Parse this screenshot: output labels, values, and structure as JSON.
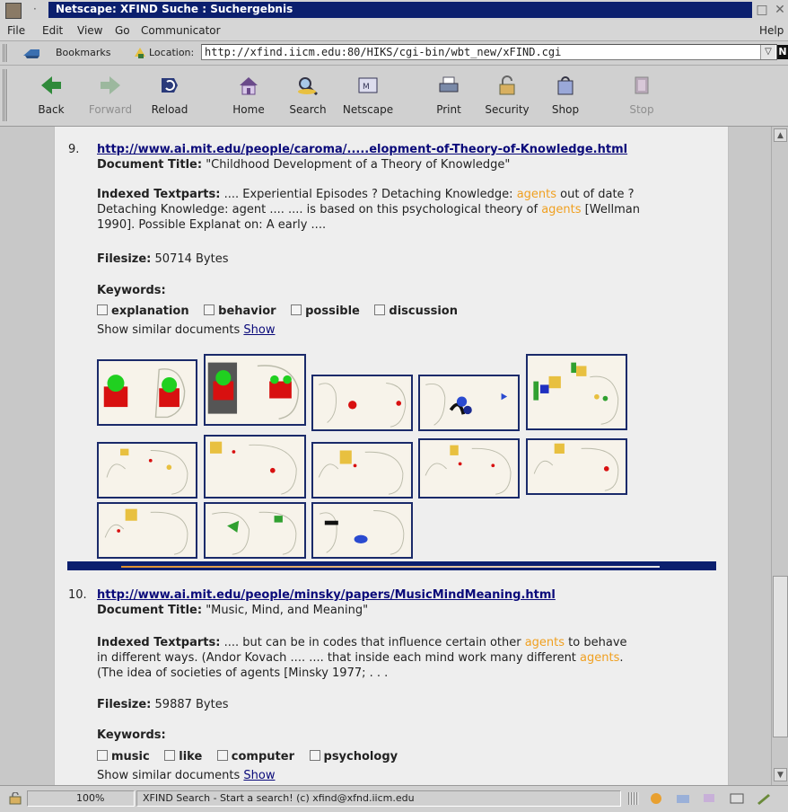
{
  "window": {
    "title": "Netscape: XFIND Suche : Suchergebnis"
  },
  "menu": [
    "File",
    "Edit",
    "View",
    "Go",
    "Communicator",
    "Help"
  ],
  "location_bar": {
    "bookmarks_label": "Bookmarks",
    "location_label": "Location:",
    "url": "http://xfind.iicm.edu:80/HIKS/cgi-bin/wbt_new/xFIND.cgi"
  },
  "toolbar": {
    "back": "Back",
    "forward": "Forward",
    "reload": "Reload",
    "home": "Home",
    "search": "Search",
    "netscape": "Netscape",
    "print": "Print",
    "security": "Security",
    "shop": "Shop",
    "stop": "Stop"
  },
  "results": [
    {
      "number": "9.",
      "url": "http://www.ai.mit.edu/people/caroma/.....elopment-of-Theory-of-Knowledge.html",
      "doc_title_label": "Document Title:",
      "doc_title": "\"Childhood Development of a Theory of Knowledge\"",
      "indexed_label": "Indexed Textparts:",
      "text_l1_a": " .... Experiential Episodes ? Detaching Knowledge: ",
      "text_l1_hl": "agents",
      "text_l1_b": " out of date ?",
      "text_l2_a": "Detaching Knowledge: agent .... .... is based on this psychological theory of ",
      "text_l2_hl": "agents",
      "text_l2_b": " [Wellman",
      "text_l3": "1990]. Possible Explanat on: A early ....",
      "filesize_label": "Filesize:",
      "filesize": " 50714 Bytes",
      "keywords_label": "Keywords:",
      "keywords": [
        "explanation",
        "behavior",
        "possible",
        "discussion"
      ],
      "similar_text": "Show similar documents ",
      "similar_link": "Show"
    },
    {
      "number": "10.",
      "url": "http://www.ai.mit.edu/people/minsky/papers/MusicMindMeaning.html",
      "doc_title_label": "Document Title:",
      "doc_title": "\"Music, Mind, and Meaning\"",
      "indexed_label": "Indexed Textparts:",
      "text_l1_a": " .... but can be in codes that influence certain other ",
      "text_l1_hl": "agents",
      "text_l1_b": " to behave",
      "text_l2_a": "in different ways. (Andor Kovach .... .... that inside each mind work many different ",
      "text_l2_hl": "agents",
      "text_l2_b": ".",
      "text_l3": "(The idea of societies of agents [Minsky 1977; . . .",
      "filesize_label": "Filesize:",
      "filesize": " 59887 Bytes",
      "keywords_label": "Keywords:",
      "keywords": [
        "music",
        "like",
        "computer",
        "psychology"
      ],
      "similar_text": "Show similar documents ",
      "similar_link": "Show"
    }
  ],
  "status_bar": {
    "zoom": "100%",
    "message": "XFIND Search  -  Start a search!    (c) xfind@xfnd.iicm.edu"
  },
  "colors": {
    "title_bar": "#0b1f6e",
    "link": "#0a0a7a",
    "highlight": "#f0a020",
    "thumb_border": "#1a2a6a"
  }
}
